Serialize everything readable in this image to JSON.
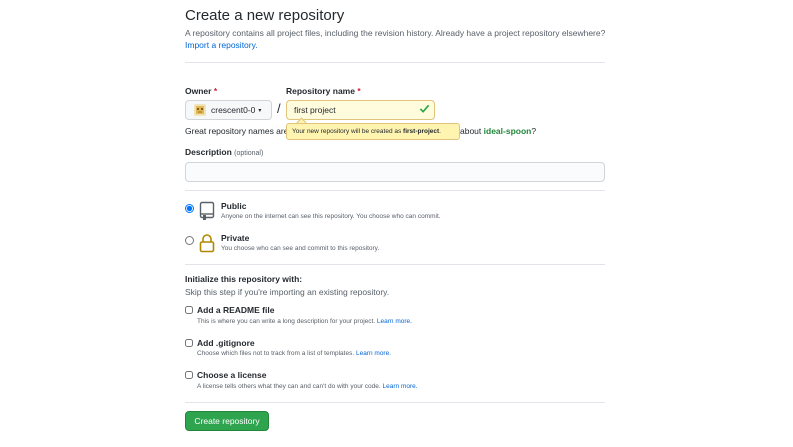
{
  "header": {
    "title": "Create a new repository",
    "subtitle": "A repository contains all project files, including the revision history. Already have a project repository elsewhere?",
    "import_link": "Import a repository."
  },
  "owner": {
    "label": "Owner",
    "required_mark": "*",
    "value": "crescent0-0",
    "caret": "▾"
  },
  "repo": {
    "label": "Repository name",
    "required_mark": "*",
    "value": "first project",
    "slash": "/",
    "tooltip_prefix": "Your new repository will be created as ",
    "tooltip_name": "first-project",
    "tooltip_suffix": ".",
    "hint_prefix": "Great repository names are",
    "hint_about": "about ",
    "suggestion": "ideal-spoon",
    "hint_suffix": "?"
  },
  "description": {
    "label": "Description",
    "optional": "(optional)",
    "value": ""
  },
  "visibility": {
    "public": {
      "title": "Public",
      "note": "Anyone on the internet can see this repository. You choose who can commit.",
      "selected": true
    },
    "private": {
      "title": "Private",
      "note": "You choose who can see and commit to this repository.",
      "selected": false
    }
  },
  "init": {
    "title": "Initialize this repository with:",
    "subtitle": "Skip this step if you're importing an existing repository.",
    "readme": {
      "title": "Add a README file",
      "note": "This is where you can write a long description for your project.",
      "link": "Learn more."
    },
    "gitignore": {
      "title": "Add .gitignore",
      "note": "Choose which files not to track from a list of templates.",
      "link": "Learn more."
    },
    "license": {
      "title": "Choose a license",
      "note": "A license tells others what they can and can't do with your code.",
      "link": "Learn more."
    }
  },
  "actions": {
    "create_label": "Create repository"
  },
  "colors": {
    "accent_link": "#0366d6",
    "success_green": "#2ea44f",
    "warning_yellow": "#fff5b1"
  }
}
